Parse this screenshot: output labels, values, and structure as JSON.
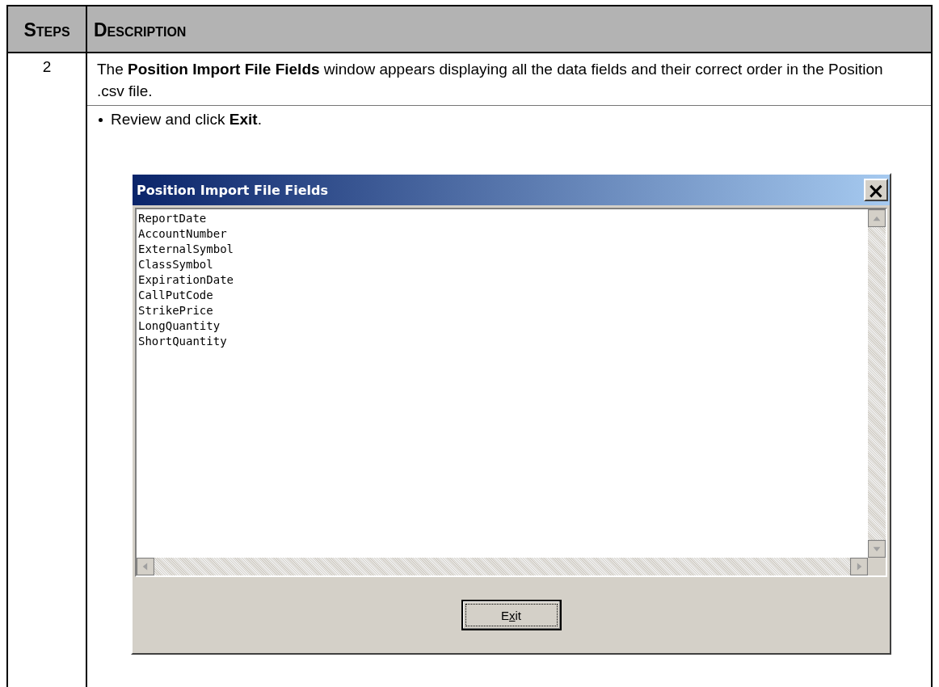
{
  "table": {
    "columns": [
      "Steps",
      "Description"
    ],
    "rows": [
      {
        "step": "2",
        "text": "The **Position Import File Fields** window appears displaying all the data fields and their correct order in the Position .csv file.",
        "bullets": [
          "Review and click **Exit**."
        ],
        "dialog": {
          "title": "Position Import File Fields",
          "close": "×",
          "items": [
            "ReportDate",
            "AccountNumber",
            "ExternalSymbol",
            "ClassSymbol",
            "ExpirationDate",
            "CallPutCode",
            "StrikePrice",
            "LongQuantity",
            "ShortQuantity"
          ],
          "button": {
            "before": "E",
            "access_key": "x",
            "after": "it",
            "focused": true
          }
        }
      }
    ]
  }
}
